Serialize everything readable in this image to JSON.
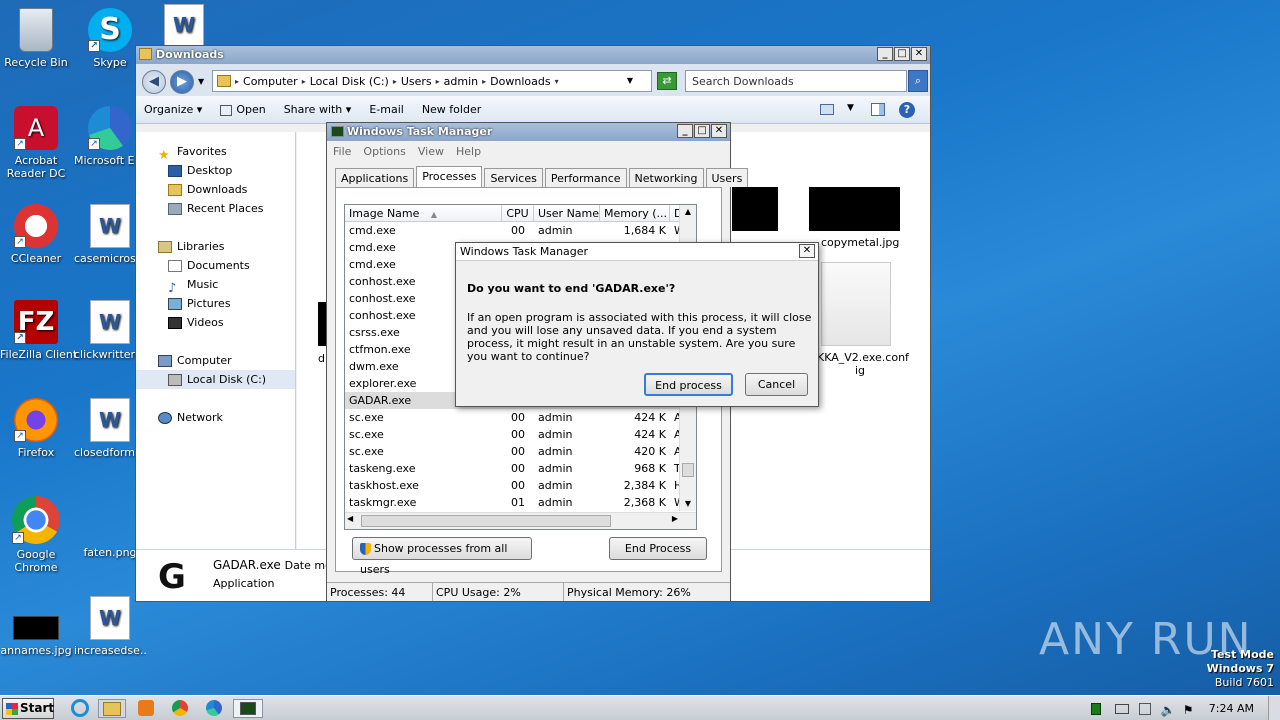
{
  "desktop_icons": [
    {
      "label": "Recycle Bin",
      "icon": "recycle-bin-icon",
      "color": "#cfd8e0"
    },
    {
      "label": "Skype",
      "icon": "skype-icon",
      "color": "#00aff0"
    },
    {
      "label": "Acrobat Reader DC",
      "icon": "acrobat-icon",
      "color": "#c8102e"
    },
    {
      "label": "Microsoft Edge",
      "icon": "edge-icon",
      "color": "#1d8bd6"
    },
    {
      "label": "CCleaner",
      "icon": "ccleaner-icon",
      "color": "#d33"
    },
    {
      "label": "casemicrosoft...",
      "icon": "word-doc-icon",
      "color": "#2b5797"
    },
    {
      "label": "FileZilla Client",
      "icon": "filezilla-icon",
      "color": "#b30000"
    },
    {
      "label": "clickwritten...",
      "icon": "word-doc-icon",
      "color": "#2b5797"
    },
    {
      "label": "Firefox",
      "icon": "firefox-icon",
      "color": "#e66000"
    },
    {
      "label": "closedforma...",
      "icon": "word-doc-icon",
      "color": "#2b5797"
    },
    {
      "label": "Google Chrome",
      "icon": "chrome-icon",
      "color": "#4285f4"
    },
    {
      "label": "faten.png",
      "icon": "image-file-icon",
      "color": "#888"
    },
    {
      "label": "annames.jpg",
      "icon": "image-file-icon",
      "color": "#000"
    },
    {
      "label": "increasedse...",
      "icon": "word-doc-icon",
      "color": "#2b5797"
    }
  ],
  "explorer": {
    "title": "Downloads",
    "breadcrumb": [
      "Computer",
      "Local Disk (C:)",
      "Users",
      "admin",
      "Downloads"
    ],
    "search_placeholder": "Search Downloads",
    "toolbar": {
      "organize": "Organize",
      "open": "Open",
      "share": "Share with",
      "email": "E-mail",
      "new_folder": "New folder"
    },
    "nav": {
      "favorites": "Favorites",
      "desktop": "Desktop",
      "downloads": "Downloads",
      "recent": "Recent Places",
      "libraries": "Libraries",
      "documents": "Documents",
      "music": "Music",
      "pictures": "Pictures",
      "videos": "Videos",
      "computer": "Computer",
      "local_disk": "Local Disk (C:)",
      "network": "Network"
    },
    "files": {
      "copymetal": "copymetal.jpg",
      "config": "KKA_V2.exe.conf ig",
      "partial_d": "d"
    },
    "details": {
      "name": "GADAR.exe",
      "date_label": "Date mod",
      "type": "Application"
    }
  },
  "taskmgr": {
    "title": "Windows Task Manager",
    "menu": [
      "File",
      "Options",
      "View",
      "Help"
    ],
    "tabs": [
      "Applications",
      "Processes",
      "Services",
      "Performance",
      "Networking",
      "Users"
    ],
    "columns": [
      "Image Name",
      "CPU",
      "User Name",
      "Memory (...",
      "D"
    ],
    "rows": [
      {
        "name": "cmd.exe",
        "cpu": "00",
        "user": "admin",
        "mem": "1,684 K",
        "d": "W"
      },
      {
        "name": "cmd.exe",
        "cpu": "",
        "user": "",
        "mem": "",
        "d": ""
      },
      {
        "name": "cmd.exe",
        "cpu": "",
        "user": "",
        "mem": "",
        "d": ""
      },
      {
        "name": "conhost.exe",
        "cpu": "",
        "user": "",
        "mem": "",
        "d": ""
      },
      {
        "name": "conhost.exe",
        "cpu": "",
        "user": "",
        "mem": "",
        "d": ""
      },
      {
        "name": "conhost.exe",
        "cpu": "",
        "user": "",
        "mem": "",
        "d": ""
      },
      {
        "name": "csrss.exe",
        "cpu": "",
        "user": "",
        "mem": "",
        "d": ""
      },
      {
        "name": "ctfmon.exe",
        "cpu": "",
        "user": "",
        "mem": "",
        "d": ""
      },
      {
        "name": "dwm.exe",
        "cpu": "",
        "user": "",
        "mem": "",
        "d": ""
      },
      {
        "name": "explorer.exe",
        "cpu": "",
        "user": "",
        "mem": "",
        "d": ""
      },
      {
        "name": "GADAR.exe",
        "cpu": "",
        "user": "",
        "mem": "",
        "d": ""
      },
      {
        "name": "sc.exe",
        "cpu": "00",
        "user": "admin",
        "mem": "424 K",
        "d": "A"
      },
      {
        "name": "sc.exe",
        "cpu": "00",
        "user": "admin",
        "mem": "424 K",
        "d": "A"
      },
      {
        "name": "sc.exe",
        "cpu": "00",
        "user": "admin",
        "mem": "420 K",
        "d": "A"
      },
      {
        "name": "taskeng.exe",
        "cpu": "00",
        "user": "admin",
        "mem": "968 K",
        "d": "T"
      },
      {
        "name": "taskhost.exe",
        "cpu": "00",
        "user": "admin",
        "mem": "2,384 K",
        "d": "H"
      },
      {
        "name": "taskmgr.exe",
        "cpu": "01",
        "user": "admin",
        "mem": "2,368 K",
        "d": "W"
      }
    ],
    "show_all_btn": "Show processes from all users",
    "end_process_btn": "End Process",
    "status": {
      "processes": "Processes: 44",
      "cpu": "CPU Usage: 2%",
      "memory": "Physical Memory: 26%"
    }
  },
  "confirm": {
    "title": "Windows Task Manager",
    "question": "Do you want to end 'GADAR.exe'?",
    "message": "If an open program is associated with this process, it will close and you will lose any unsaved data. If you end a system process, it might result in an unstable system. Are you sure you want to continue?",
    "end_btn": "End process",
    "cancel_btn": "Cancel"
  },
  "taskbar": {
    "start": "Start",
    "clock": "7:24 AM"
  },
  "watermark": "ANY RUN",
  "testmode": [
    "Test Mode",
    "Windows 7",
    "Build 7601"
  ]
}
